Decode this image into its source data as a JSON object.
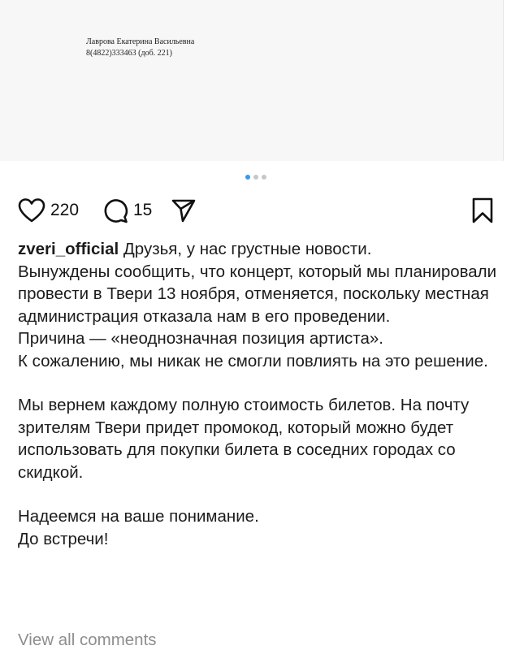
{
  "document": {
    "name": "Лаврова Екатерина Васильевна",
    "phone": "8(4822)333463 (доб. 221)"
  },
  "carousel": {
    "total": 3,
    "active": 1
  },
  "actions": {
    "likes": "220",
    "comments": "15",
    "icons": [
      "heart-icon",
      "comment-icon",
      "send-icon",
      "bookmark-icon"
    ]
  },
  "post": {
    "username": "zveri_official",
    "first_line": " Друзья, у нас грустные новости.",
    "p1": "Вынуждены сообщить, что концерт, который мы планировали провести в Твери 13 ноября, отменяется, поскольку местная администрация отказала нам в его проведении.",
    "p2": "Причина — «неоднозначная позиция артиста».",
    "p3": "К сожалению, мы никак не смогли повлиять на это решение.",
    "p4": "Мы вернем каждому полную стоимость билетов. На почту зрителям Твери придет промокод, который можно будет использовать для покупки билета в соседних городах со скидкой.",
    "p5": "Надеемся на ваше понимание.",
    "p6": "До встречи!"
  },
  "view_all": "View all comments",
  "colors": {
    "accent": "#3897f0",
    "muted": "#8e8e8e",
    "text": "#1c1c1c"
  }
}
